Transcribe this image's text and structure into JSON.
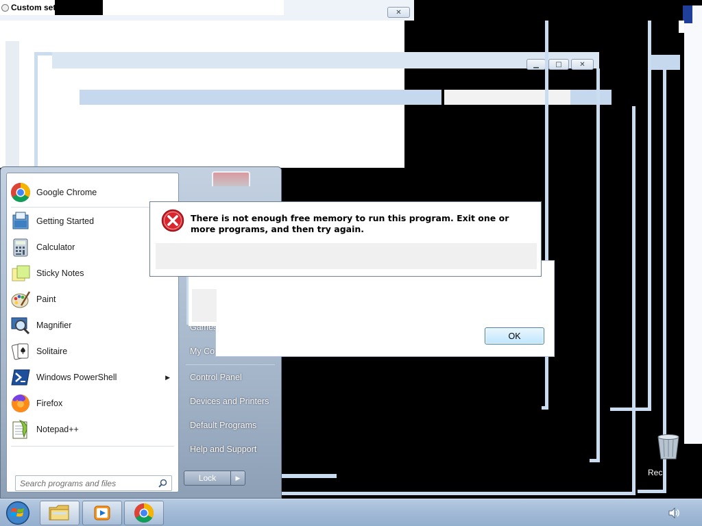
{
  "background_window": {
    "title": "Custom set"
  },
  "caption_buttons": {
    "minimize": "▁",
    "maximize": "□",
    "close": "✕"
  },
  "start_menu": {
    "programs": [
      {
        "label": "Google Chrome",
        "icon": "chrome-icon"
      },
      {
        "label": "Getting Started",
        "icon": "getting-started-icon"
      },
      {
        "label": "Calculator",
        "icon": "calculator-icon"
      },
      {
        "label": "Sticky Notes",
        "icon": "sticky-notes-icon"
      },
      {
        "label": "Paint",
        "icon": "paint-icon"
      },
      {
        "label": "Magnifier",
        "icon": "magnifier-icon"
      },
      {
        "label": "Solitaire",
        "icon": "solitaire-icon"
      },
      {
        "label": "Windows PowerShell",
        "icon": "powershell-icon",
        "submenu_arrow": "▶"
      },
      {
        "label": "Firefox",
        "icon": "firefox-icon"
      },
      {
        "label": "Notepad++",
        "icon": "notepadpp-icon"
      }
    ],
    "search_placeholder": "Search programs and files",
    "right_items": {
      "games": "Games",
      "my_computer": "My Co",
      "control_panel": "Control Panel",
      "devices_printers": "Devices and Printers",
      "default_programs": "Default Programs",
      "help_support": "Help and Support"
    },
    "lock_label": "Lock",
    "lock_arrow": "▶"
  },
  "error_dialog": {
    "message": "There is not enough free memory to run this program. Exit one or more programs, and then try again.",
    "ok_label": "OK"
  },
  "desktop": {
    "recycle_bin_label": "Rec"
  },
  "taskbar": {
    "buttons": [
      {
        "name": "explorer",
        "icon": "folder-icon"
      },
      {
        "name": "media-player",
        "icon": "media-player-icon"
      },
      {
        "name": "chrome",
        "icon": "chrome-icon"
      }
    ]
  },
  "colors": {
    "window_frame": "#c9dcf0",
    "taskbar": "#a3bbd7",
    "error_red": "#d9262e"
  }
}
